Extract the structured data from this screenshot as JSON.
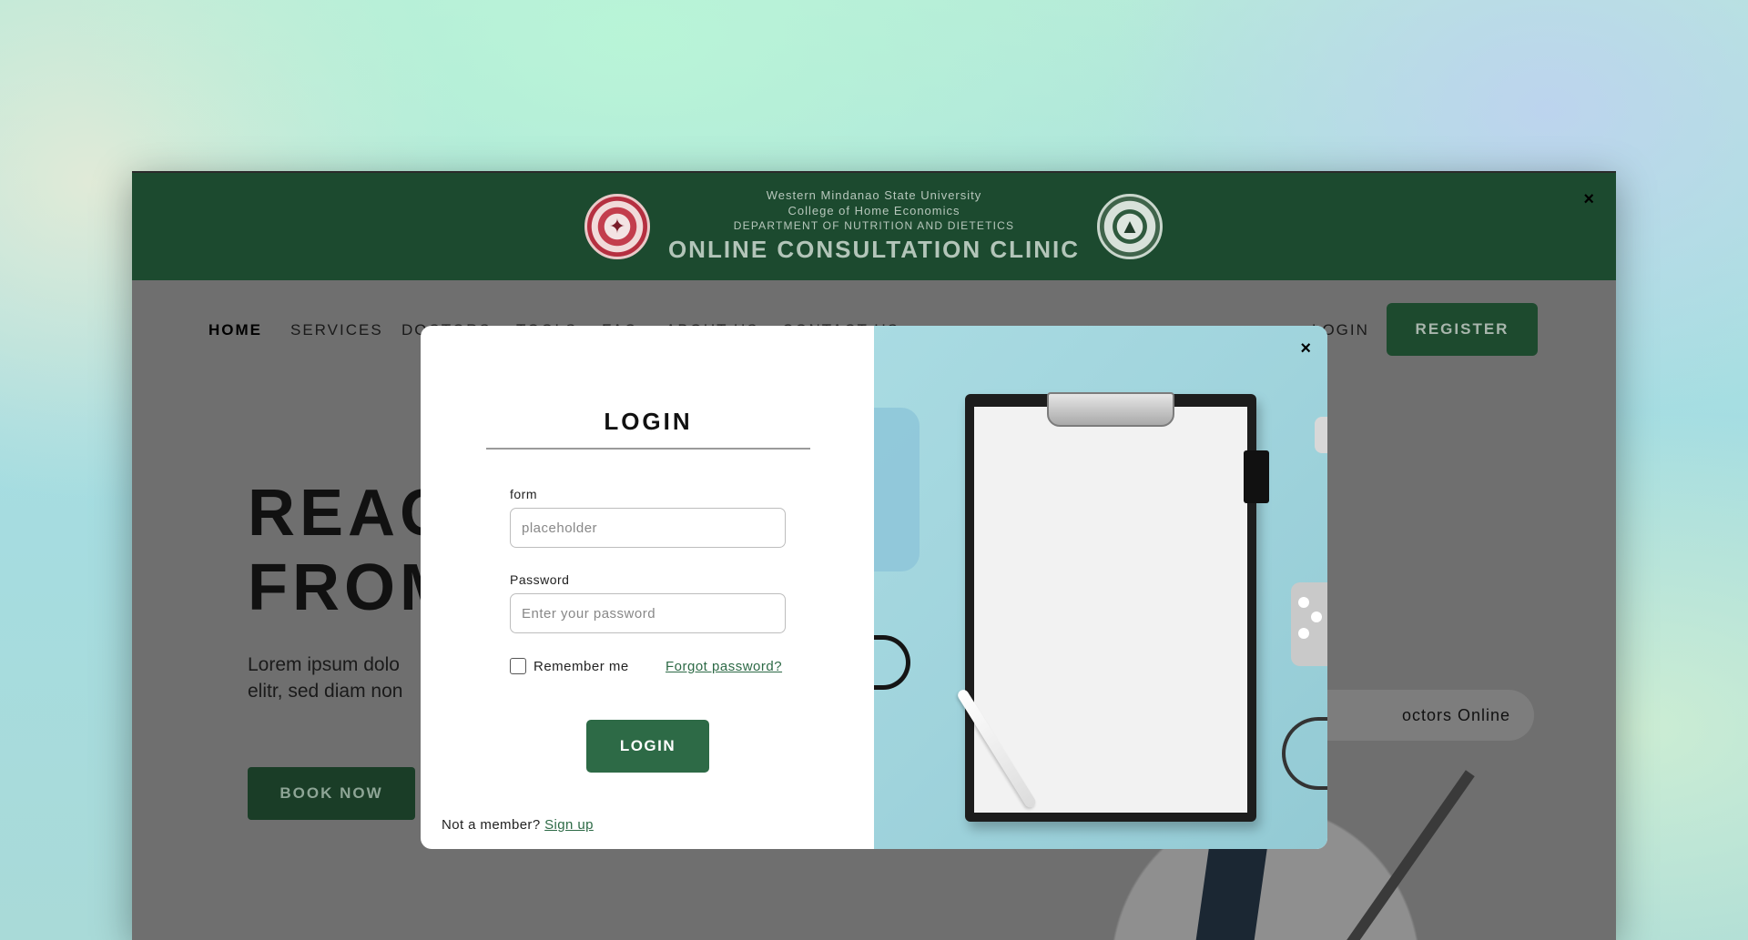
{
  "banner": {
    "university": "Western Mindanao State University",
    "college": "College of Home Economics",
    "department": "DEPARTMENT OF NUTRITION AND DIETETICS",
    "title": "ONLINE CONSULTATION CLINIC",
    "close_glyph": "×"
  },
  "nav": {
    "items": [
      {
        "label": "HOME"
      },
      {
        "label": "SERVICES"
      },
      {
        "label": "DOCTORS"
      },
      {
        "label": "TOOLS"
      },
      {
        "label": "FAQ"
      },
      {
        "label": "ABOUT US"
      },
      {
        "label": "CONTACT US"
      }
    ],
    "login_label": "LOGIN",
    "register_label": "REGISTER"
  },
  "hero": {
    "title_line1": "REAC",
    "title_line2": "FROM",
    "text_line1": "Lorem ipsum dolo",
    "text_line2": "elitr, sed diam non",
    "book_label": "BOOK NOW",
    "doctors_pill": "octors Online"
  },
  "modal": {
    "title": "LOGIN",
    "form_label": "form",
    "form_placeholder": "placeholder",
    "password_label": "Password",
    "password_placeholder": "Enter your password",
    "remember_label": "Remember me",
    "forgot_label": "Forgot password?",
    "login_button": "LOGIN",
    "not_member": "Not a member?",
    "signup_label": "Sign up",
    "close_glyph": "×"
  },
  "colors": {
    "brand_green": "#2d6a46",
    "banner_green": "#1c4a2f",
    "overlay_gray": "#6f6f6f"
  },
  "icons": {
    "banner_close": "close-icon",
    "modal_close": "close-icon",
    "left_seal": "university-seal-icon",
    "right_seal": "college-seal-icon"
  }
}
